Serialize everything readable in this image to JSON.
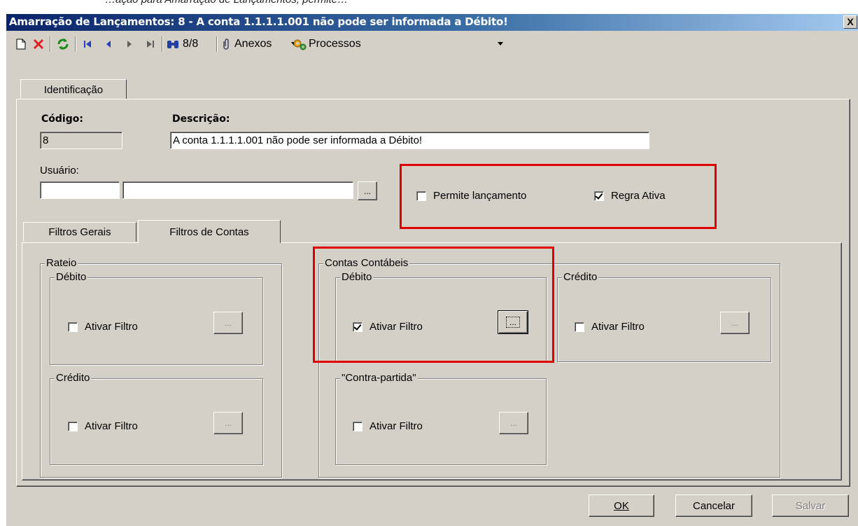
{
  "top_strip_text": "…ação para Amarração de Lançamentos, permite…",
  "window": {
    "title": "Amarração de Lançamentos: 8 - A conta 1.1.1.1.001 não pode ser informada a Débito!",
    "close_glyph": "X"
  },
  "toolbar": {
    "record_counter": "8/8",
    "attachments_label": "Anexos",
    "processes_label": "Processos"
  },
  "tabs_main": [
    {
      "label": "Identificação"
    }
  ],
  "form": {
    "codigo_label": "Código:",
    "codigo_value": "8",
    "descricao_label": "Descrição:",
    "descricao_value": "A conta 1.1.1.1.001 não pode ser informada a Débito!",
    "usuario_label": "Usuário:",
    "usuario_code": "",
    "usuario_name": "",
    "lookup_button": "...",
    "permite_lancamento": {
      "label": "Permite lançamento",
      "checked": false
    },
    "regra_ativa": {
      "label": "Regra Ativa",
      "checked": true
    }
  },
  "tabs_filters": [
    {
      "label": "Filtros Gerais"
    },
    {
      "label": "Filtros de Contas"
    }
  ],
  "rateio": {
    "title": "Rateio",
    "debito": {
      "title": "Débito",
      "checkbox_label": "Ativar Filtro",
      "checked": false,
      "button": "..."
    },
    "credito": {
      "title": "Crédito",
      "checkbox_label": "Ativar Filtro",
      "checked": false,
      "button": "..."
    }
  },
  "contas": {
    "title": "Contas Contábeis",
    "debito": {
      "title": "Débito",
      "checkbox_label": "Ativar Filtro",
      "checked": true,
      "button": "..."
    },
    "credito": {
      "title": "Crédito",
      "checkbox_label": "Ativar Filtro",
      "checked": false,
      "button": "..."
    },
    "contrapartida": {
      "title": "\"Contra-partida\"",
      "checkbox_label": "Ativar Filtro",
      "checked": false,
      "button": "..."
    }
  },
  "footer": {
    "ok": "OK",
    "cancelar": "Cancelar",
    "salvar": "Salvar"
  },
  "colors": {
    "title_bar_start": "#0a246a",
    "title_bar_end": "#a6caf0",
    "window_bg": "#d4d0c8",
    "highlight_red": "#e00000"
  }
}
